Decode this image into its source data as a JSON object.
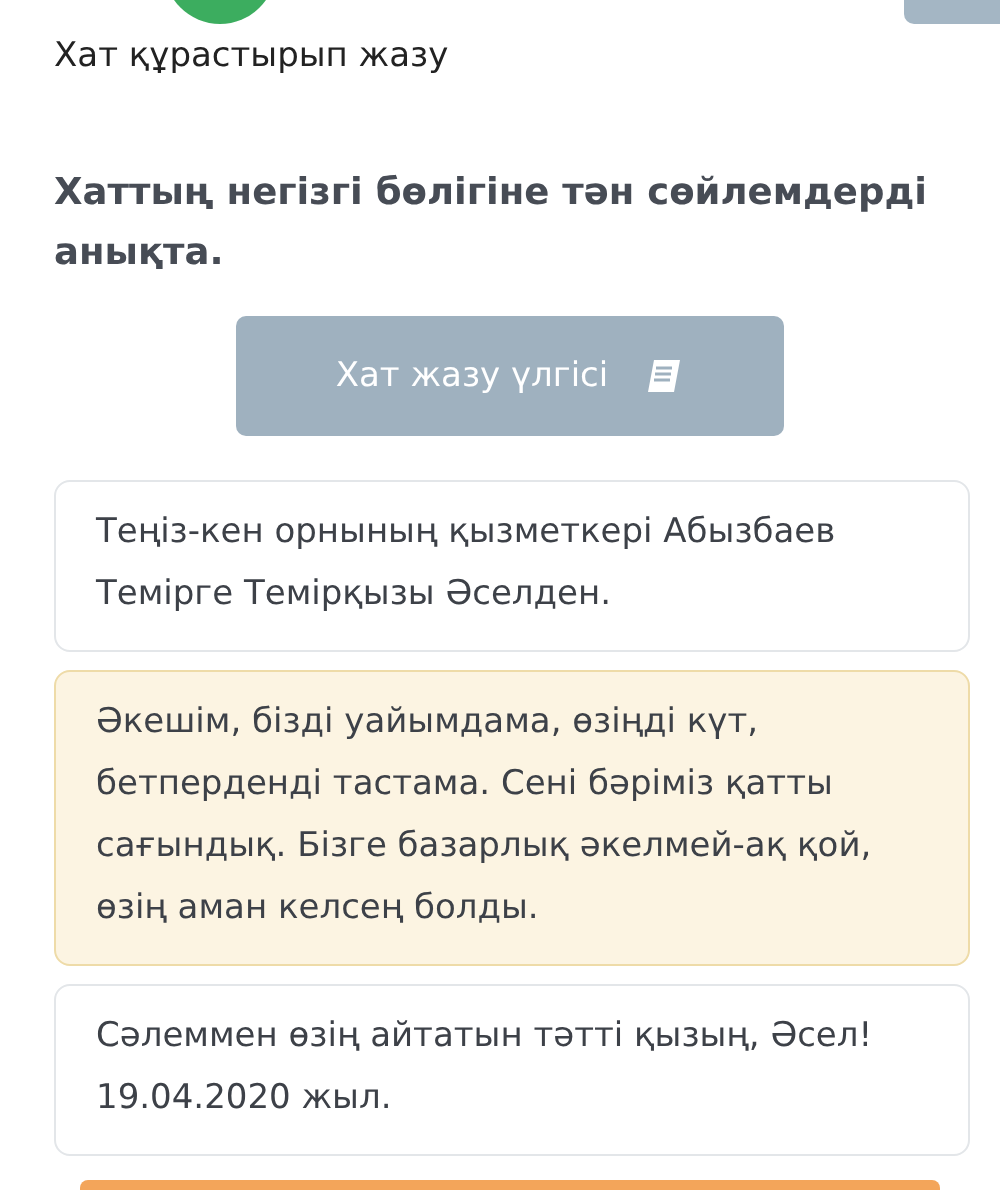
{
  "title": "Хат құрастырып жазу",
  "question": "Хаттың негізгі бөлігіне тән сөйлемдерді анықта.",
  "hint_button": {
    "label": "Хат жазу үлгісі"
  },
  "options": [
    {
      "text": "Теңіз-кен орнының қызметкері Абызбаев Темірге Темірқызы Әселден.",
      "selected": false
    },
    {
      "text": "Әкешім, бізді уайымдама, өзіңді күт, бетперденді тастама. Сені бәріміз қатты сағындық. Бізге базарлық әкелмей-ақ қой, өзің аман келсең болды.",
      "selected": true
    },
    {
      "text": "Сәлеммен өзің айтатын тәтті қызың, Әсел! 19.04.2020 жыл.",
      "selected": false
    }
  ]
}
